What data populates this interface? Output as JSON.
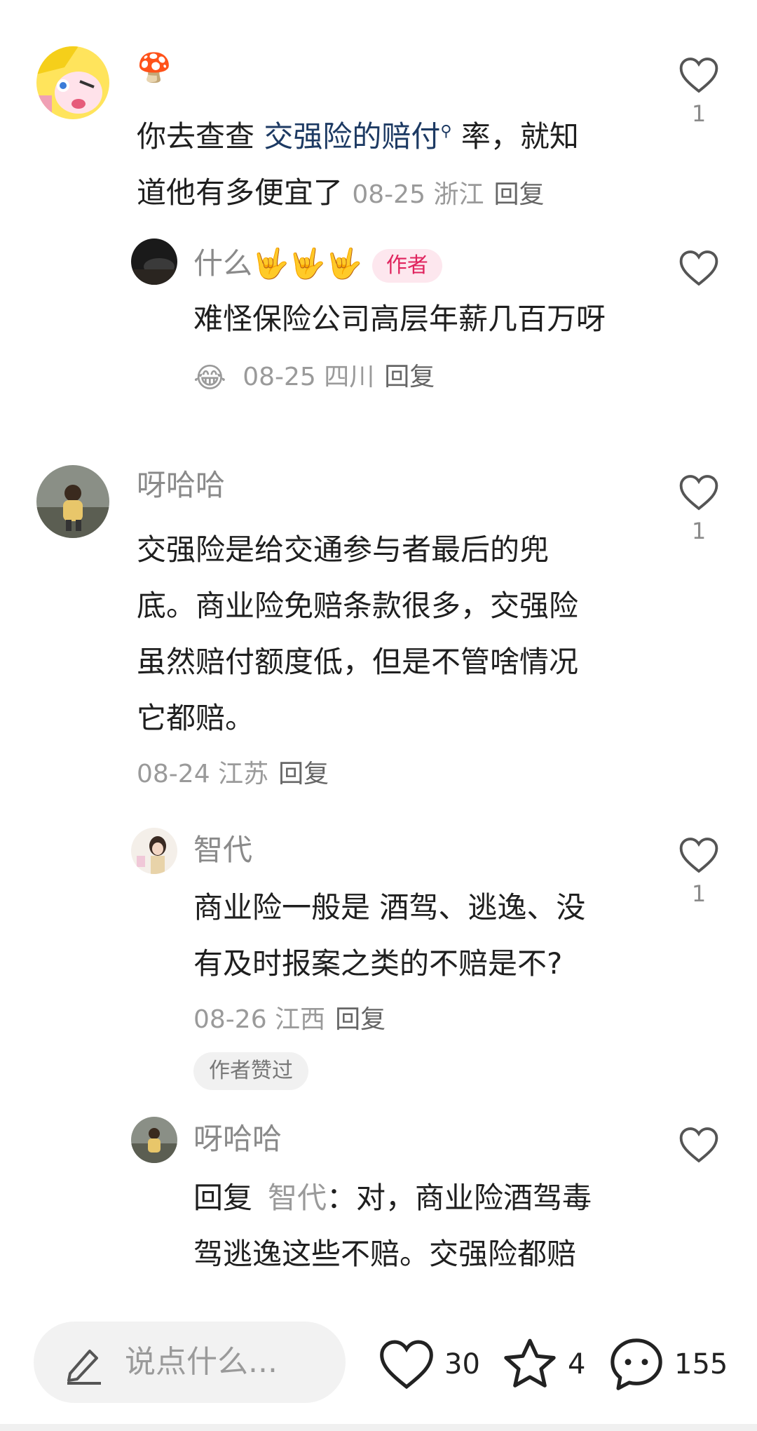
{
  "comments": [
    {
      "id": "c1",
      "name_emoji": "🍄",
      "text_before": "你去查查 ",
      "highlight": "交强险的赔付",
      "text_after_line1": " 率，就知",
      "text_line2": "道他有多便宜了",
      "date": "08-25",
      "location": "浙江",
      "reply_label": "回复",
      "likes": "1"
    },
    {
      "id": "r1",
      "name": "什么🤟🤟🤟",
      "author_badge": "作者",
      "text": "难怪保险公司高层年薪几百万呀",
      "date": "08-25",
      "location": "四川",
      "reply_label": "回复",
      "likes": ""
    },
    {
      "id": "c2",
      "name": "呀哈哈",
      "lines": [
        "交强险是给交通参与者最后的兜",
        "底。商业险免赔条款很多，交强险",
        "虽然赔付额度低，但是不管啥情况",
        "它都赔。"
      ],
      "date": "08-24",
      "location": "江苏",
      "reply_label": "回复",
      "likes": "1"
    },
    {
      "id": "r2",
      "name": "智代",
      "lines": [
        "商业险一般是 酒驾、逃逸、没",
        "有及时报案之类的不赔是不?"
      ],
      "date": "08-26",
      "location": "江西",
      "reply_label": "回复",
      "liked_badge": "作者赞过",
      "likes": "1"
    },
    {
      "id": "r3",
      "name": "呀哈哈",
      "reply_prefix": "回复",
      "mention": "智代",
      "line1_rest": "：对，商业险酒驾毒",
      "line2": "驾逃逸这些不赔。交强险都赔",
      "likes": ""
    }
  ],
  "bottom_bar": {
    "input_placeholder": "说点什么...",
    "likes_count": "30",
    "favorites_count": "4",
    "comments_count": "155"
  },
  "colors": {
    "highlight_link": "#1d3a63",
    "author_badge": "#e0245e",
    "meta_gray": "#9a9a9a"
  }
}
